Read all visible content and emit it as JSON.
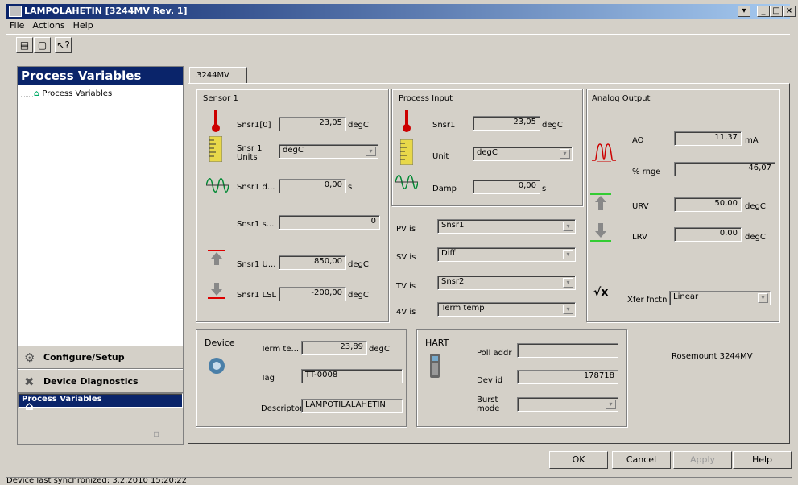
{
  "window": {
    "title": "LAMPOLAHETIN [3244MV Rev. 1]"
  },
  "menu": [
    "File",
    "Actions",
    "Help"
  ],
  "left": {
    "header": "Process Variables",
    "tree_item": "Process Variables",
    "nav": [
      {
        "label": "Configure/Setup"
      },
      {
        "label": "Device Diagnostics"
      },
      {
        "label": "Process Variables"
      }
    ]
  },
  "tab": "3244MV",
  "sensor1": {
    "title": "Sensor 1",
    "snsr": {
      "label": "Snsr1[0]",
      "value": "23,05",
      "unit": "degC"
    },
    "units": {
      "label": "Snsr 1 Units",
      "value": "degC"
    },
    "damp": {
      "label": "Snsr1 d...",
      "value": "0,00",
      "unit": "s"
    },
    "s": {
      "label": "Snsr1 s...",
      "value": "0"
    },
    "usl": {
      "label": "Snsr1 U...",
      "value": "850,00",
      "unit": "degC"
    },
    "lsl": {
      "label": "Snsr1 LSL",
      "value": "-200,00",
      "unit": "degC"
    }
  },
  "process_input": {
    "title": "Process Input",
    "snsr": {
      "label": "Snsr1",
      "value": "23,05",
      "unit": "degC"
    },
    "unit": {
      "label": "Unit",
      "value": "degC"
    },
    "damp": {
      "label": "Damp",
      "value": "0,00",
      "unit": "s"
    }
  },
  "vars": [
    {
      "label": "PV is",
      "value": "Snsr1"
    },
    {
      "label": "SV is",
      "value": "Diff"
    },
    {
      "label": "TV is",
      "value": "Snsr2"
    },
    {
      "label": "4V is",
      "value": "Term temp"
    }
  ],
  "analog": {
    "title": "Analog Output",
    "ao": {
      "label": "AO",
      "value": "11,37",
      "unit": "mA"
    },
    "rnge": {
      "label": "% rnge",
      "value": "46,07"
    },
    "urv": {
      "label": "URV",
      "value": "50,00",
      "unit": "degC"
    },
    "lrv": {
      "label": "LRV",
      "value": "0,00",
      "unit": "degC"
    },
    "xfer": {
      "label": "Xfer fnctn",
      "value": "Linear"
    }
  },
  "device": {
    "title": "Device",
    "term": {
      "label": "Term te...",
      "value": "23,89",
      "unit": "degC"
    },
    "tag": {
      "label": "Tag",
      "value": "TT-0008"
    },
    "desc": {
      "label": "Descriptor",
      "value": "LAMPOTILALAHETIN"
    }
  },
  "hart": {
    "title": "HART",
    "poll": {
      "label": "Poll addr",
      "value": ""
    },
    "devid": {
      "label": "Dev id",
      "value": "178718"
    },
    "burst": {
      "label": "Burst mode",
      "value": ""
    }
  },
  "model": "Rosemount 3244MV",
  "buttons": {
    "ok": "OK",
    "cancel": "Cancel",
    "apply": "Apply",
    "help": "Help"
  },
  "status": "Device last synchronized: 3.2.2010 15:20:22"
}
